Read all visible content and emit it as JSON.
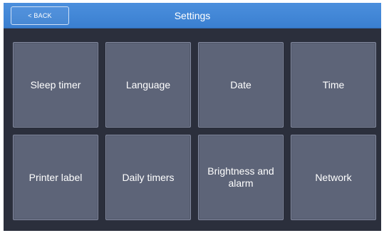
{
  "header": {
    "back_label": "< BACK",
    "title": "Settings"
  },
  "tiles": [
    {
      "label": "Sleep timer"
    },
    {
      "label": "Language"
    },
    {
      "label": "Date"
    },
    {
      "label": "Time"
    },
    {
      "label": "Printer label"
    },
    {
      "label": "Daily timers"
    },
    {
      "label": "Brightness and alarm"
    },
    {
      "label": "Network"
    }
  ],
  "colors": {
    "header": "#3f85d6",
    "background": "#2b2f3c",
    "tile": "#5d6478",
    "tile_border": "#838aa0"
  }
}
